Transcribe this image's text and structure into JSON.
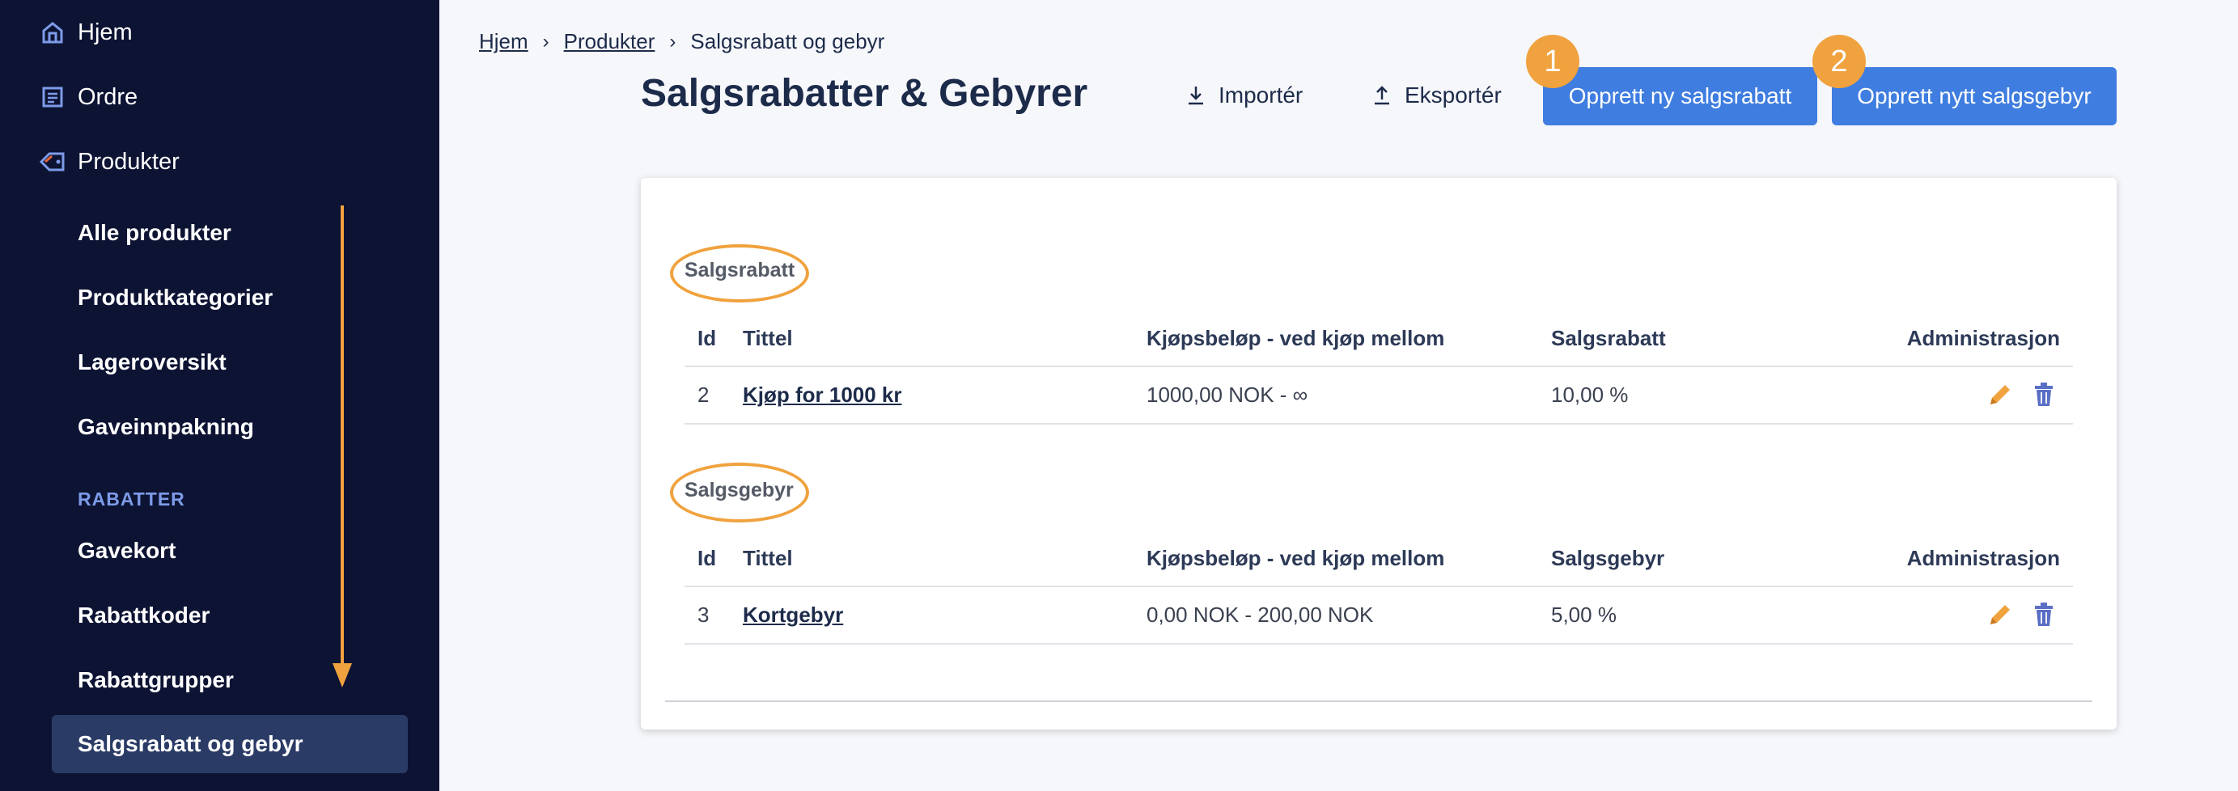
{
  "sidebar": {
    "top_items": [
      {
        "label": "Hjem",
        "icon": "home-icon"
      },
      {
        "label": "Ordre",
        "icon": "orders-icon"
      },
      {
        "label": "Produkter",
        "icon": "tag-icon"
      }
    ],
    "product_items": [
      "Alle produkter",
      "Produktkategorier",
      "Lageroversikt",
      "Gaveinnpakning"
    ],
    "section_title": "RABATTER",
    "discount_items": [
      "Gavekort",
      "Rabattkoder",
      "Rabattgrupper"
    ],
    "active_item": "Salgsrabatt og gebyr"
  },
  "breadcrumb": [
    "Hjem",
    "Produkter",
    "Salgsrabatt og gebyr"
  ],
  "page_title": "Salgsrabatter & Gebyrer",
  "toolbar": {
    "import_label": "Importér",
    "export_label": "Eksportér",
    "create_discount_label": "Opprett ny salgsrabatt",
    "create_fee_label": "Opprett nytt salgsgebyr",
    "badge_1": "1",
    "badge_2": "2"
  },
  "discount_table": {
    "title": "Salgsrabatt",
    "headers": [
      "Id",
      "Tittel",
      "Kjøpsbeløp - ved kjøp mellom",
      "Salgsrabatt",
      "Administrasjon"
    ],
    "rows": [
      {
        "id": "2",
        "title": "Kjøp for 1000 kr",
        "range": "1000,00 NOK - ∞",
        "value": "10,00 %"
      }
    ]
  },
  "fee_table": {
    "title": "Salgsgebyr",
    "headers": [
      "Id",
      "Tittel",
      "Kjøpsbeløp - ved kjøp mellom",
      "Salgsgebyr",
      "Administrasjon"
    ],
    "rows": [
      {
        "id": "3",
        "title": "Kortgebyr",
        "range": "0,00 NOK - 200,00 NOK",
        "value": "5,00 %"
      }
    ]
  },
  "colors": {
    "sidebar_bg": "#0d1333",
    "primary": "#3f7de0",
    "annotation": "#f0a23e",
    "edit_icon": "#f0a23e",
    "delete_icon": "#5a6fc4"
  }
}
